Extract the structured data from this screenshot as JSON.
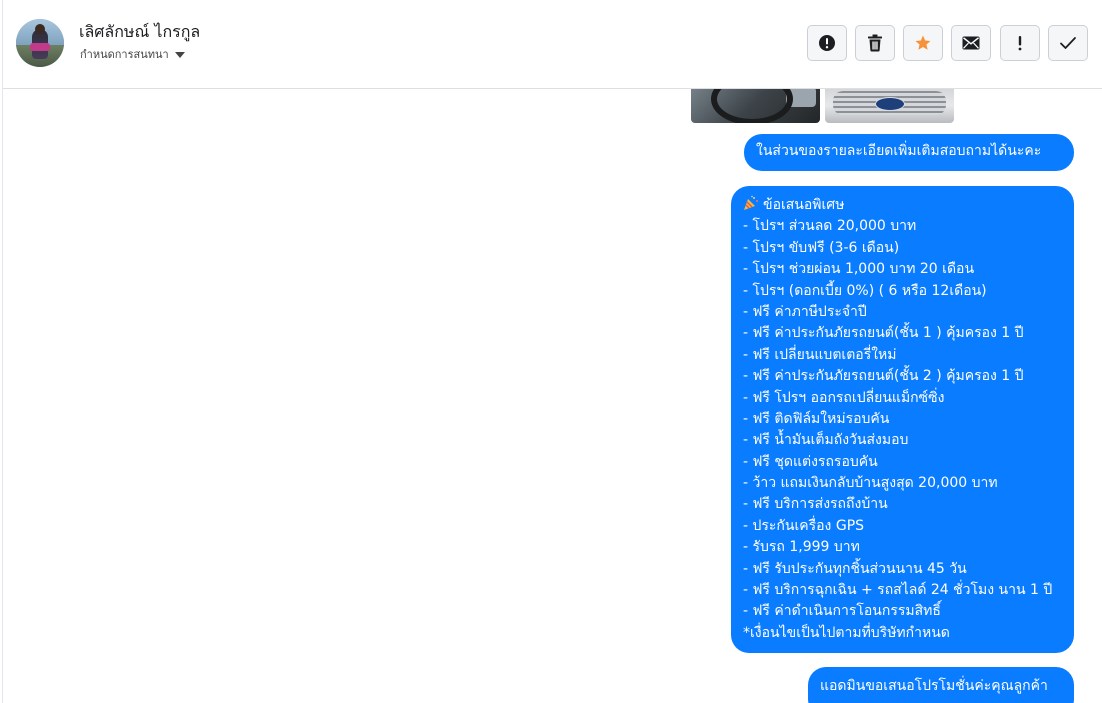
{
  "header": {
    "contact_name": "เลิศลักษณ์ ไกรกูล",
    "subtitle": "กำหนดการสนทนา",
    "toolbar": [
      {
        "name": "alert-icon",
        "label": "!"
      },
      {
        "name": "trash-icon",
        "label": ""
      },
      {
        "name": "star-icon",
        "label": ""
      },
      {
        "name": "mail-icon",
        "label": ""
      },
      {
        "name": "exclamation-icon",
        "label": "!"
      },
      {
        "name": "check-icon",
        "label": ""
      }
    ]
  },
  "colors": {
    "bubble": "#0a7cff",
    "star": "#f7923b",
    "border": "#ccd0d5"
  },
  "messages": {
    "msg1": "ในส่วนของรายละเอียดเพิ่มเติมสอบถามได้นะคะ",
    "offer": {
      "icon": "party-popper-icon",
      "title": "ข้อเสนอพิเศษ",
      "lines": [
        " - โปรฯ ส่วนลด 20,000 บาท",
        " - โปรฯ ขับฟรี (3-6 เดือน)",
        " - โปรฯ ช่วยผ่อน 1,000 บาท 20 เดือน",
        " - โปรฯ (ดอกเบี้ย 0%) ( 6 หรือ 12เดือน)",
        " - ฟรี ค่าภาษีประจำปี",
        " - ฟรี ค่าประกันภัยรถยนต์(ชั้น 1 ) คุ้มครอง 1 ปี",
        " - ฟรี เปลี่ยนแบตเตอรี่ใหม่",
        " - ฟรี ค่าประกันภัยรถยนต์(ชั้น 2 ) คุ้มครอง 1 ปี",
        " - ฟรี โปรฯ ออกรถเปลี่ยนแม็กซ์ซิ่ง",
        " - ฟรี ติดฟิล์มใหม่รอบคัน",
        " - ฟรี น้ำมันเต็มถังวันส่งมอบ",
        " - ฟรี ชุดแต่งรถรอบคัน",
        " - ว้าว แถมเงินกลับบ้านสูงสุด 20,000 บาท",
        " - ฟรี บริการส่งรถถึงบ้าน",
        " - ประกันเครื่อง GPS",
        " - รับรถ 1,999 บาท",
        " - ฟรี รับประกันทุกชิ้นส่วนนาน 45 วัน",
        " - ฟรี บริการฉุกเฉิน + รถสไลด์ 24 ชั่วโมง นาน 1 ปี",
        " - ฟรี ค่าดำเนินการโอนกรรมสิทธิ์",
        "*เงื่อนไขเป็นไปตามที่บริษัทกำหนด"
      ]
    },
    "msg3": "แอดมินขอเสนอโปรโมชั่นค่ะคุณลูกค้า"
  }
}
